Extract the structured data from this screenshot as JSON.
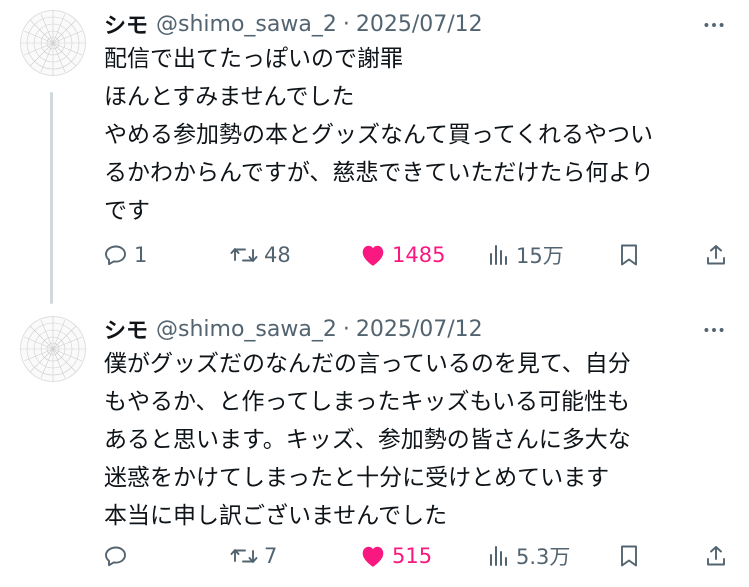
{
  "tweets": [
    {
      "name": "シモ",
      "handle": "@shimo_sawa_2",
      "separator": "·",
      "date": "2025/07/12",
      "text_lines": [
        "配信で出てたっぽいので謝罪",
        "ほんとすみませんでした",
        "やめる参加勢の本とグッズなんて買ってくれるやつい",
        "るかわからんですが、慈悲できていただけたら何より",
        "です"
      ],
      "replies": "1",
      "reposts": "48",
      "likes": "1485",
      "views": "15万"
    },
    {
      "name": "シモ",
      "handle": "@shimo_sawa_2",
      "separator": "·",
      "date": "2025/07/12",
      "text_lines": [
        "僕がグッズだのなんだの言っているのを見て、自分",
        "もやるか、と作ってしまったキッズもいる可能性も",
        "あると思います。キッズ、参加勢の皆さんに多大な",
        "迷惑をかけてしまったと十分に受けとめています",
        "本当に申し訳ございませんでした"
      ],
      "replies": "",
      "reposts": "7",
      "likes": "515",
      "views": "5.3万"
    }
  ],
  "icons": {
    "reply": "reply-icon",
    "repost": "repost-icon",
    "like": "heart-icon",
    "views": "views-icon",
    "bookmark": "bookmark-icon",
    "share": "share-icon",
    "more": "more-icon"
  },
  "colors": {
    "text": "#0f1419",
    "secondary": "#536471",
    "like": "#f91880",
    "thread_line": "#cfd9de"
  }
}
